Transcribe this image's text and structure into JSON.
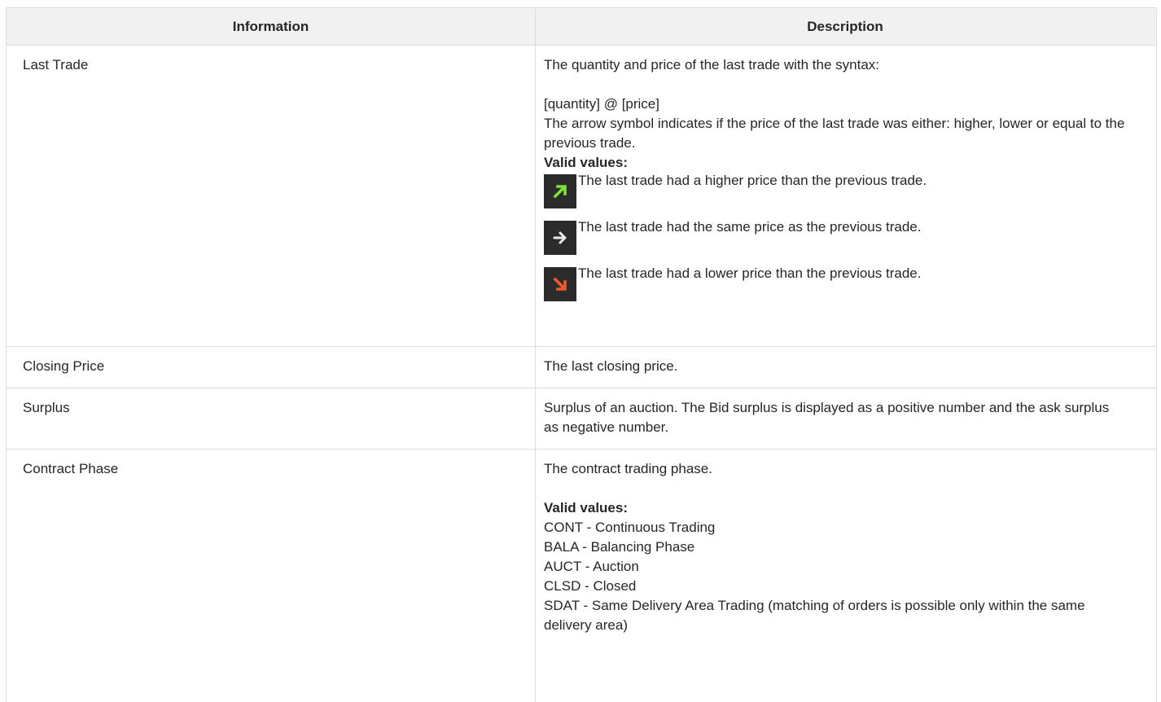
{
  "table": {
    "headers": {
      "information": "Information",
      "description": "Description"
    },
    "rows": {
      "last_trade": {
        "info": "Last Trade",
        "desc_intro": "The quantity and price of the last trade with the syntax:",
        "desc_syntax": "[quantity] @ [price]",
        "desc_arrow": "The arrow symbol indicates if the price of the last trade was either: higher, lower or equal to the previous trade.",
        "valid_label": "Valid values:",
        "values": [
          {
            "icon": "arrow-up-right-green-icon",
            "color": "#7ee03a",
            "text": "The last trade had a higher price than the previous trade."
          },
          {
            "icon": "arrow-right-white-icon",
            "color": "#e8e8e8",
            "text": "The last trade had the same price as the previous trade."
          },
          {
            "icon": "arrow-down-right-red-icon",
            "color": "#f0582e",
            "text": "The last trade had a lower price than the previous trade."
          }
        ]
      },
      "closing_price": {
        "info": "Closing Price",
        "desc": "The last closing price."
      },
      "surplus": {
        "info": "Surplus",
        "desc": "Surplus of an auction. The Bid surplus is displayed as a positive number and the ask surplus as negative number."
      },
      "contract_phase": {
        "info": "Contract Phase",
        "desc_intro": "The contract trading phase.",
        "valid_label": "Valid values:",
        "values": [
          "CONT - Continuous Trading",
          "BALA - Balancing Phase",
          "AUCT - Auction",
          "CLSD - Closed",
          "SDAT - Same Delivery Area Trading (matching of orders is possible only within the same delivery area)"
        ]
      }
    }
  }
}
